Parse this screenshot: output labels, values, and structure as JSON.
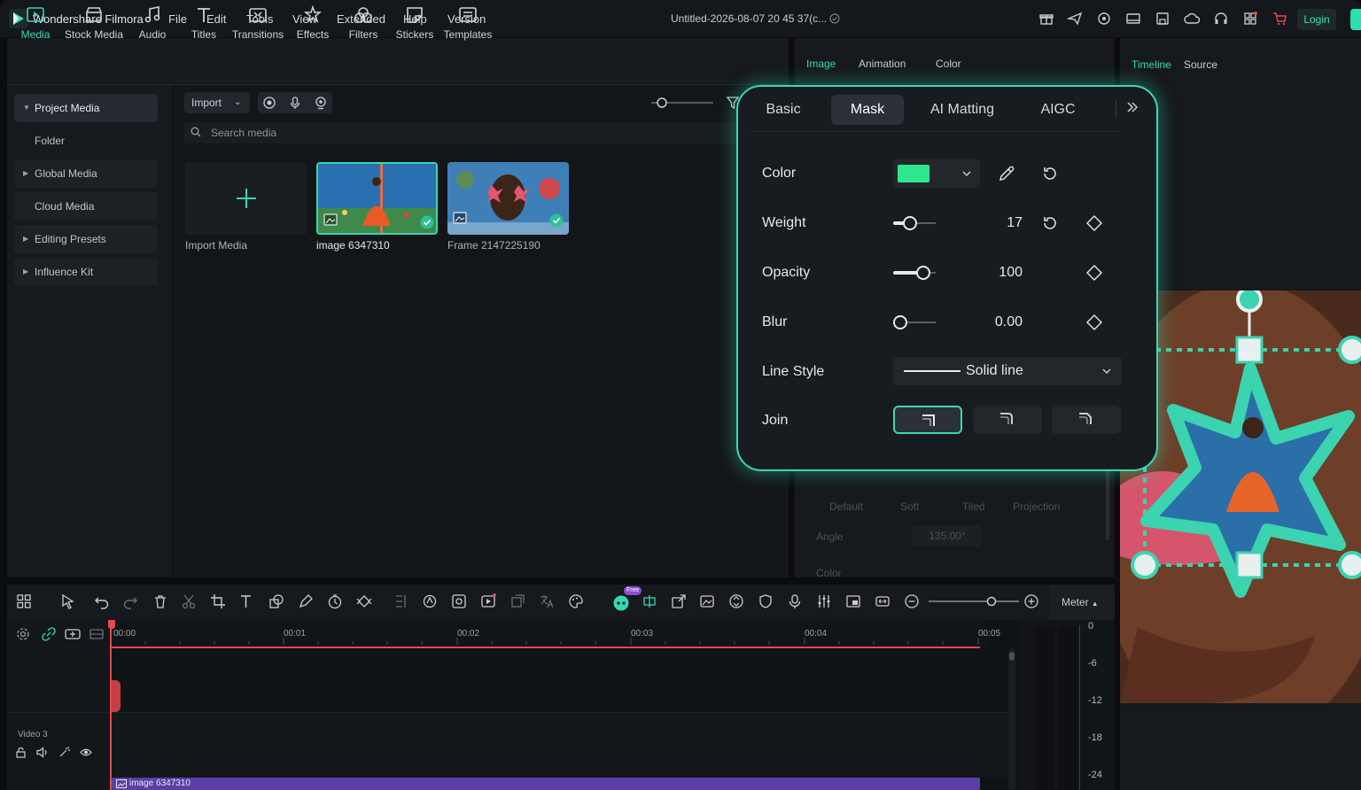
{
  "titlebar": {
    "app_name": "Wondershare Filmora",
    "menus": [
      "File",
      "Edit",
      "Tools",
      "View",
      "Extended",
      "Help",
      "Version"
    ],
    "document_title": "Untitled-2026-08-07 20 45 37(c...",
    "login_label": "Login"
  },
  "toolbar": {
    "items": [
      {
        "label": "Media",
        "icon": "media-icon",
        "active": true
      },
      {
        "label": "Stock Media",
        "icon": "stock-media-icon"
      },
      {
        "label": "Audio",
        "icon": "audio-icon"
      },
      {
        "label": "Titles",
        "icon": "titles-icon"
      },
      {
        "label": "Transitions",
        "icon": "transitions-icon"
      },
      {
        "label": "Effects",
        "icon": "effects-icon"
      },
      {
        "label": "Filters",
        "icon": "filters-icon"
      },
      {
        "label": "Stickers",
        "icon": "stickers-icon"
      },
      {
        "label": "Templates",
        "icon": "templates-icon"
      }
    ]
  },
  "sidebar": {
    "items": [
      {
        "label": "Project Media",
        "expandable": true,
        "selected": true
      },
      {
        "label": "Folder"
      },
      {
        "label": "Global Media",
        "expandable": true
      },
      {
        "label": "Cloud Media"
      },
      {
        "label": "Editing Presets",
        "expandable": true
      },
      {
        "label": "Influence Kit",
        "expandable": true
      }
    ]
  },
  "media": {
    "import_label": "Import",
    "search_placeholder": "Search media",
    "import_media_label": "Import Media",
    "items": [
      {
        "label": "image 6347310",
        "selected": true
      },
      {
        "label": "Frame 2147225190"
      }
    ]
  },
  "properties": {
    "tabs": [
      "Image",
      "Animation",
      "Color"
    ],
    "faint": {
      "styles": [
        "Default",
        "Soft",
        "Tiled",
        "Projection"
      ],
      "angle_label": "Angle",
      "angle_value": "135.00°",
      "color_label": "Color"
    }
  },
  "preview": {
    "tabs": [
      "Timeline",
      "Source"
    ]
  },
  "popup": {
    "tabs": [
      "Basic",
      "Mask",
      "AI Matting",
      "AIGC"
    ],
    "active_tab": "Mask",
    "rows": {
      "color": {
        "label": "Color",
        "swatch": "#2de88f"
      },
      "weight": {
        "label": "Weight",
        "value": "17",
        "level": 0.34
      },
      "opacity": {
        "label": "Opacity",
        "value": "100",
        "level": 0.82
      },
      "blur": {
        "label": "Blur",
        "value": "0.00",
        "level": 0.0
      },
      "line_style": {
        "label": "Line Style",
        "value": "Solid line"
      },
      "join": {
        "label": "Join",
        "options": [
          "miter",
          "round",
          "bevel"
        ],
        "selected": "miter"
      }
    }
  },
  "timeline": {
    "ruler": [
      "00:00",
      "00:01",
      "00:02",
      "00:03",
      "00:04",
      "00:05"
    ],
    "track_label": "Video 3",
    "clip_label": "image 6347310",
    "meter_label": "Meter",
    "meter_scale": [
      "0",
      "-6",
      "-12",
      "-18",
      "-24"
    ],
    "free_badge": "Free"
  },
  "colors": {
    "accent": "#33d9b2",
    "playhead": "#e5484d",
    "clip": "#5b3fa6"
  }
}
